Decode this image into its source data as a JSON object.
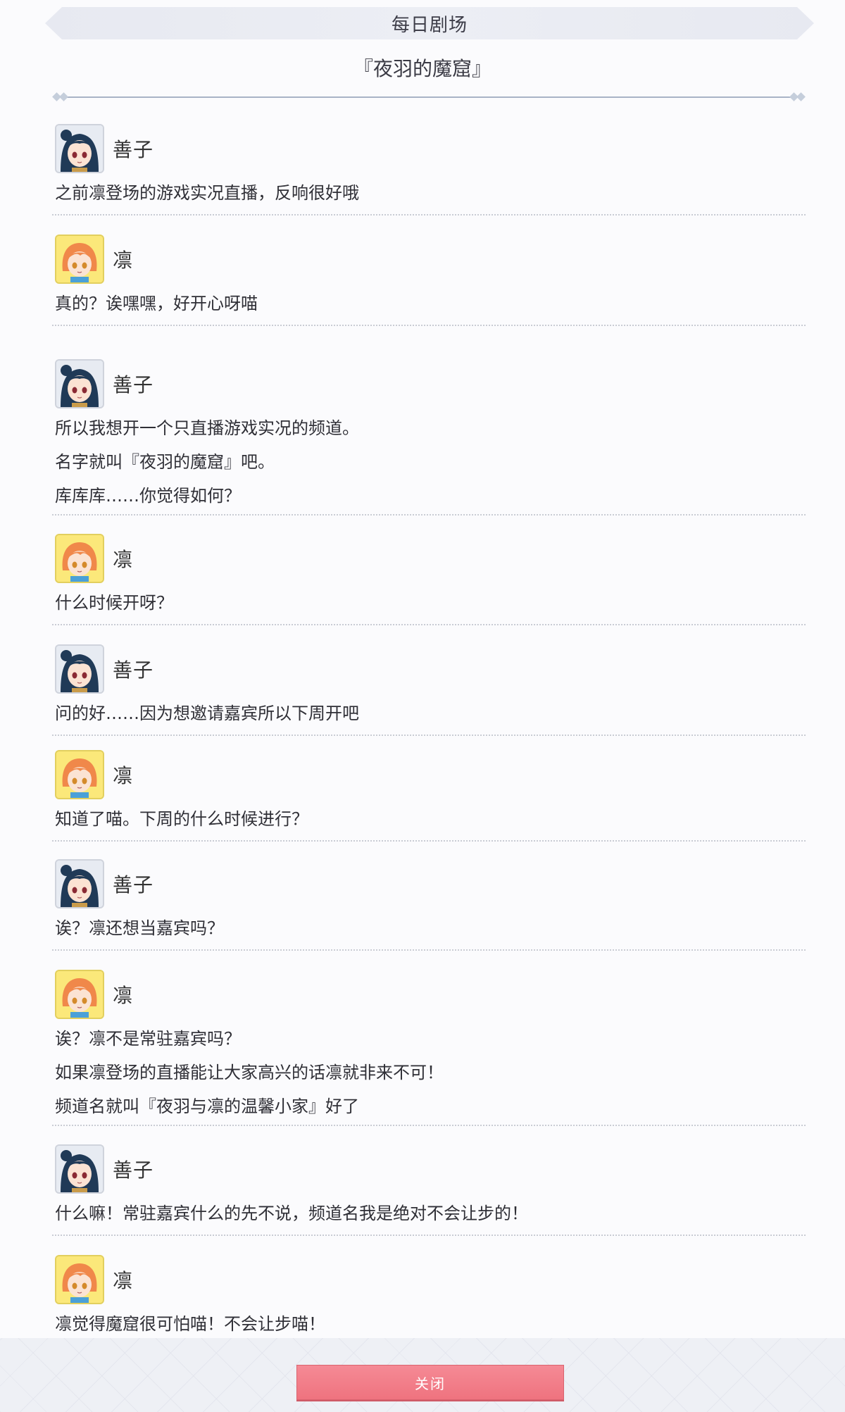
{
  "header": {
    "title": "每日剧场"
  },
  "story": {
    "title": "『夜羽的魔窟』"
  },
  "dialog": [
    {
      "speaker": "善子",
      "avatar": "yoshiko",
      "lines": [
        "之前凛登场的游戏实况直播，反响很好哦"
      ]
    },
    {
      "speaker": "凛",
      "avatar": "rin",
      "lines": [
        "真的？诶嘿嘿，好开心呀喵"
      ]
    },
    {
      "speaker": "善子",
      "avatar": "yoshiko",
      "lines": [
        "所以我想开一个只直播游戏实况的频道。",
        "名字就叫『夜羽的魔窟』吧。",
        "库库库……你觉得如何？"
      ]
    },
    {
      "speaker": "凛",
      "avatar": "rin",
      "lines": [
        "什么时候开呀？"
      ]
    },
    {
      "speaker": "善子",
      "avatar": "yoshiko",
      "lines": [
        "问的好……因为想邀请嘉宾所以下周开吧"
      ]
    },
    {
      "speaker": "凛",
      "avatar": "rin",
      "lines": [
        "知道了喵。下周的什么时候进行？"
      ]
    },
    {
      "speaker": "善子",
      "avatar": "yoshiko",
      "lines": [
        "诶？凛还想当嘉宾吗？"
      ]
    },
    {
      "speaker": "凛",
      "avatar": "rin",
      "lines": [
        "诶？凛不是常驻嘉宾吗？",
        "如果凛登场的直播能让大家高兴的话凛就非来不可！",
        "频道名就叫『夜羽与凛的温馨小家』好了"
      ]
    },
    {
      "speaker": "善子",
      "avatar": "yoshiko",
      "lines": [
        "什么嘛！常驻嘉宾什么的先不说，频道名我是绝对不会让步的！"
      ]
    },
    {
      "speaker": "凛",
      "avatar": "rin",
      "lines": [
        "凛觉得魔窟很可怕喵！不会让步喵！"
      ]
    }
  ],
  "footer": {
    "close_label": "关闭"
  }
}
